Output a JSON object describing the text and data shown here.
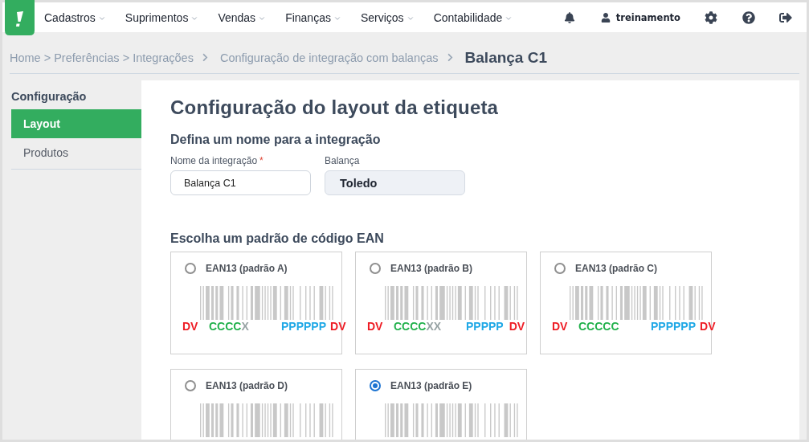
{
  "nav": {
    "menu": [
      "Cadastros",
      "Suprimentos",
      "Vendas",
      "Finanças",
      "Serviços",
      "Contabilidade"
    ],
    "user": "treinamento"
  },
  "breadcrumb": [
    {
      "text": "Home > Preferências > Integrações",
      "current": false
    },
    {
      "text": "Configuração de integração com balanças",
      "current": false
    },
    {
      "text": "Balança C1",
      "current": true
    }
  ],
  "sidebar": {
    "title": "Configuração",
    "items": [
      {
        "label": "Layout",
        "selected": true
      },
      {
        "label": "Produtos",
        "selected": false
      }
    ]
  },
  "main": {
    "title": "Configuração do layout da etiqueta",
    "name_section": "Defina um nome para a integração",
    "fields": [
      {
        "kind": "input",
        "label": "Nome da integração",
        "required_mark": "*",
        "value": "Balança C1"
      },
      {
        "kind": "readonly",
        "label": "Balança",
        "value": "Toledo"
      }
    ],
    "ean_section": "Escolha um padrão de código EAN",
    "patterns": [
      {
        "label": "EAN13 (padrão A)",
        "selected": false,
        "code": {
          "check_left": "DV",
          "company": "CCCC",
          "company_pad": "X",
          "product": "PPPPPP",
          "check_right": "DV"
        }
      },
      {
        "label": "EAN13 (padrão B)",
        "selected": false,
        "code": {
          "check_left": "DV",
          "company": "CCCC",
          "company_pad": "XX",
          "product": "PPPPP",
          "check_right": "DV"
        }
      },
      {
        "label": "EAN13 (padrão C)",
        "selected": false,
        "code": {
          "check_left": "DV",
          "company": "CCCCC",
          "product": "PPPPPP",
          "check_right": "DV"
        }
      },
      {
        "label": "EAN13 (padrão D)",
        "selected": false
      },
      {
        "label": "EAN13 (padrão E)",
        "selected": true
      }
    ]
  }
}
